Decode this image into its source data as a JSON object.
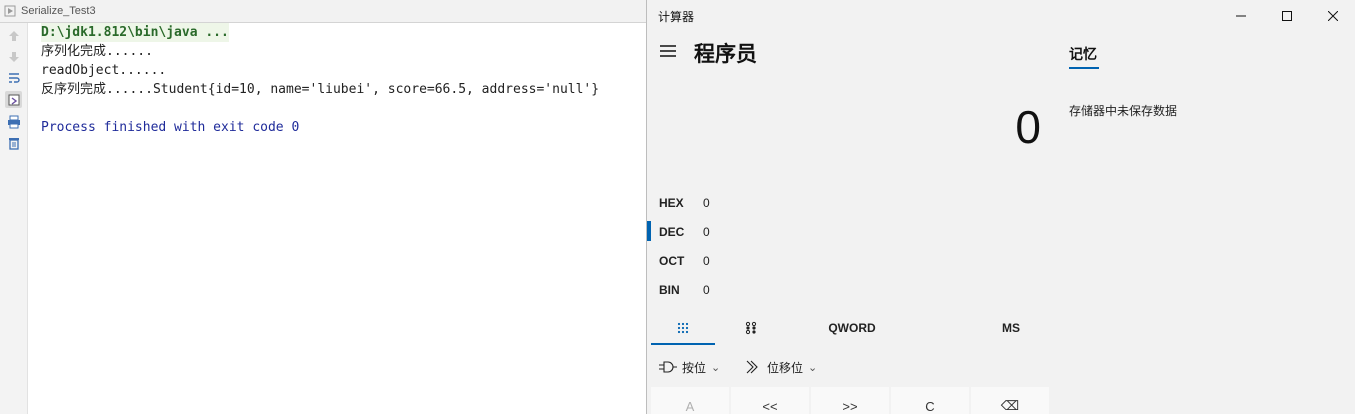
{
  "ide": {
    "tab_title": "Serialize_Test3",
    "console_lines": [
      "D:\\jdk1.812\\bin\\java ...",
      "序列化完成......",
      "readObject......",
      "反序列完成......Student{id=10, name='liubei', score=66.5, address='null'}",
      "",
      "Process finished with exit code 0"
    ]
  },
  "calculator": {
    "window_title": "计算器",
    "mode_title": "程序员",
    "display_value": "0",
    "radix": [
      {
        "label": "HEX",
        "value": "0"
      },
      {
        "label": "DEC",
        "value": "0"
      },
      {
        "label": "OCT",
        "value": "0"
      },
      {
        "label": "BIN",
        "value": "0"
      }
    ],
    "word_size": "QWORD",
    "memory_store_button": "MS",
    "bitwise_label": "按位",
    "bitshift_label": "位移位",
    "keys": [
      "A",
      "<<",
      ">>",
      "C",
      "⌫"
    ],
    "memory": {
      "tab_label": "记忆",
      "empty_message": "存储器中未保存数据"
    },
    "accent_color": "#0063b1"
  }
}
